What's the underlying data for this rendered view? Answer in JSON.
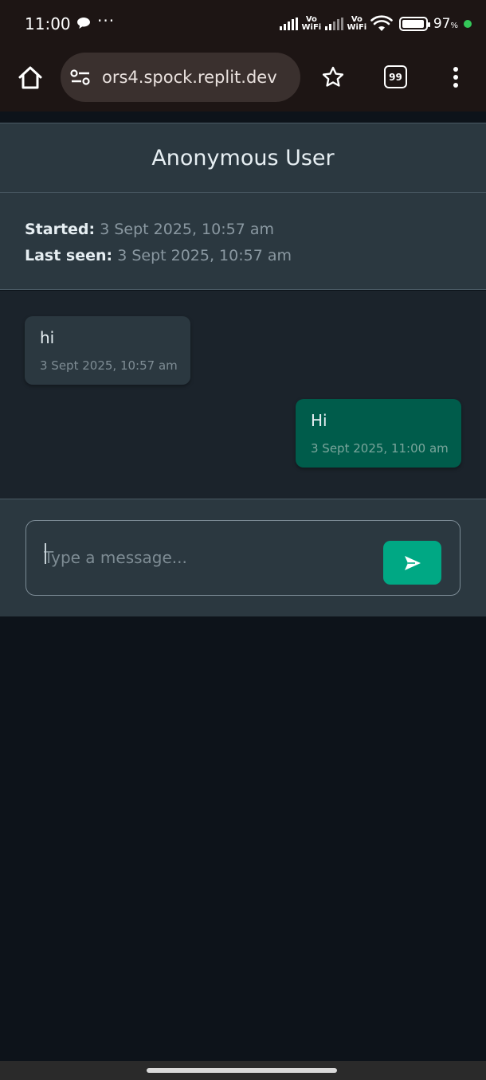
{
  "status_bar": {
    "time": "11:00",
    "vowifi_label_1": "Vo\nWiFi",
    "vowifi_label_2": "Vo\nWiFi",
    "battery_percent": "97",
    "battery_percent_sign": "%",
    "battery_level": 0.97,
    "icons": [
      "chat-bubble-icon",
      "more-dots-icon",
      "signal-icon",
      "signal-icon",
      "wifi-icon",
      "battery-icon"
    ]
  },
  "browser": {
    "url": "ors4.spock.replit.dev",
    "tab_count": "99",
    "icons": [
      "home-icon",
      "site-settings-icon",
      "star-icon",
      "tabs-icon",
      "kebab-menu-icon"
    ]
  },
  "chat": {
    "title": "Anonymous User",
    "started_label": "Started:",
    "started_value": "3 Sept 2025, 10:57 am",
    "last_seen_label": "Last seen:",
    "last_seen_value": "3 Sept 2025, 10:57 am",
    "messages": [
      {
        "text": "hi",
        "time": "3 Sept 2025, 10:57 am",
        "direction": "incoming"
      },
      {
        "text": "Hi",
        "time": "3 Sept 2025, 11:00 am",
        "direction": "outgoing"
      }
    ]
  },
  "composer": {
    "placeholder": "Type a message...",
    "value": "",
    "send_icon": "send-arrow-icon"
  },
  "colors": {
    "header_bg": "#2b3840",
    "messages_bg": "#1b232b",
    "outgoing_bubble": "#005c4b",
    "send_button": "#00a884",
    "browser_bg": "#1d1514"
  }
}
